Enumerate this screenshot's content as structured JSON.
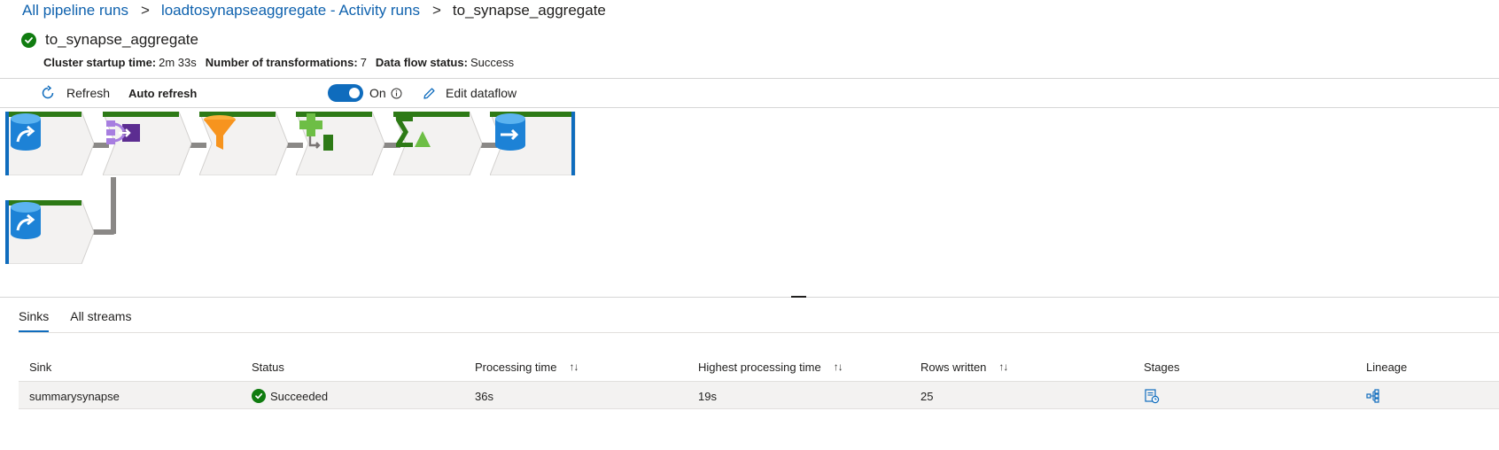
{
  "breadcrumb": {
    "items": [
      "All pipeline runs",
      "loadtosynapseaggregate - Activity runs"
    ],
    "separator": ">",
    "current": "to_synapse_aggregate"
  },
  "header": {
    "title": "to_synapse_aggregate",
    "status_icon": "success-check-icon",
    "meta": [
      {
        "key": "Cluster startup time:",
        "value": "2m 33s"
      },
      {
        "key": "Number of transformations:",
        "value": "7"
      },
      {
        "key": "Data flow status:",
        "value": "Success"
      }
    ]
  },
  "toolbar": {
    "refresh_label": "Refresh",
    "auto_refresh_label": "Auto refresh",
    "toggle_label": "On",
    "toggle_on": true,
    "edit_label": "Edit dataflow"
  },
  "flow": {
    "colors": {
      "status_bar": "#2d7a16",
      "node_bg": "#f3f2f1",
      "selected_border": "#0f6cbd",
      "connector": "#8a8886"
    },
    "nodes": [
      {
        "icon": "source-database-icon",
        "selected": true
      },
      {
        "icon": "join-icon",
        "selected": false
      },
      {
        "icon": "filter-funnel-icon",
        "selected": false
      },
      {
        "icon": "derived-column-icon",
        "selected": false
      },
      {
        "icon": "aggregate-icon",
        "selected": false
      },
      {
        "icon": "sink-database-icon",
        "selected": true
      },
      {
        "icon": "source-database-icon",
        "selected": true
      }
    ]
  },
  "tabs": [
    {
      "label": "Sinks",
      "active": true
    },
    {
      "label": "All streams",
      "active": false
    }
  ],
  "table": {
    "columns": [
      "Sink",
      "Status",
      "Processing time",
      "Highest processing time",
      "Rows written",
      "Stages",
      "Lineage"
    ],
    "sortable": [
      false,
      false,
      true,
      true,
      true,
      false,
      false
    ],
    "rows": [
      {
        "sink": "summarysynapse",
        "status": "Succeeded",
        "processing_time": "36s",
        "highest_processing_time": "19s",
        "rows_written": "25",
        "stages_icon": "stages-icon",
        "lineage_icon": "lineage-icon"
      }
    ]
  }
}
